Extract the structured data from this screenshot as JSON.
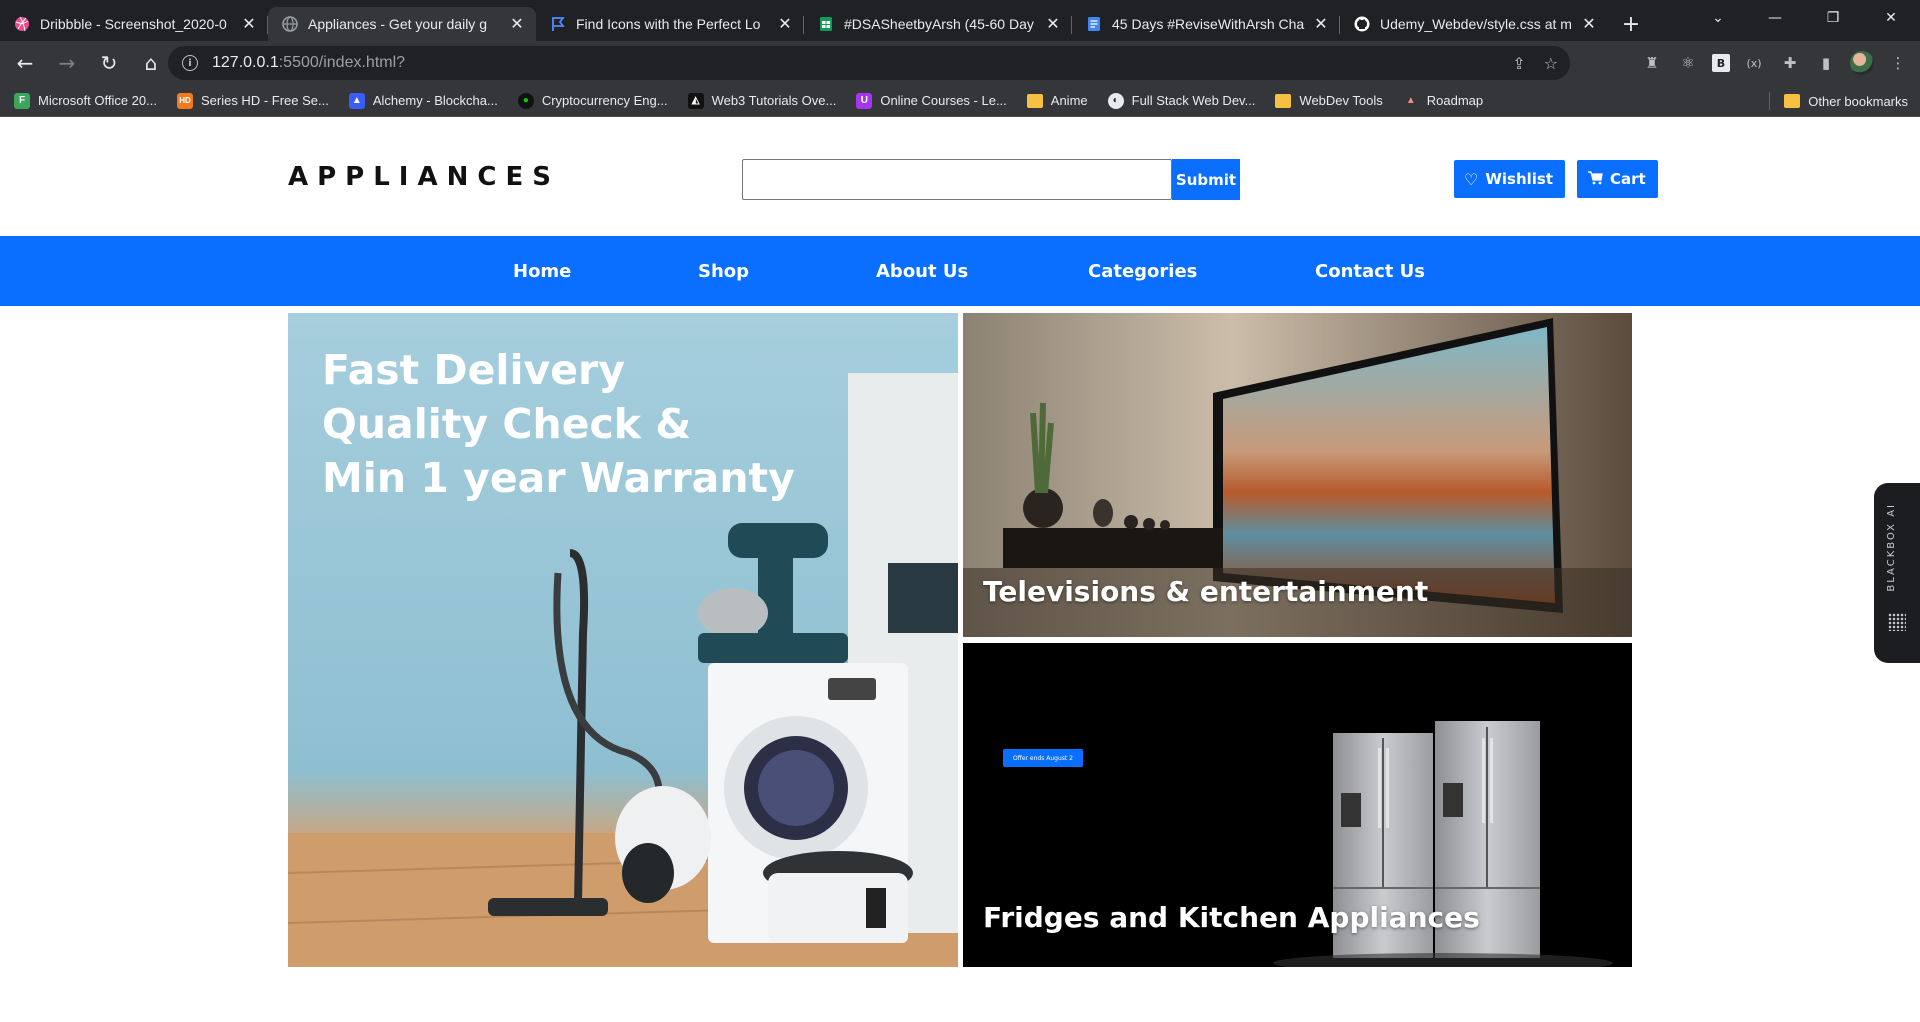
{
  "browser": {
    "tabs": [
      {
        "title": "Dribbble - Screenshot_2020-0",
        "icon": "dribbble-icon",
        "icon_color": "#ea4c89",
        "active": false
      },
      {
        "title": "Appliances - Get your daily g",
        "icon": "globe-icon",
        "icon_color": "#9aa0a6",
        "active": true
      },
      {
        "title": "Find Icons with the Perfect Lo",
        "icon": "flag-icon",
        "icon_color": "#4f8cff",
        "active": false
      },
      {
        "title": "#DSASheetbyArsh (45-60 Day",
        "icon": "sheets-icon",
        "icon_color": "#0f9d58",
        "active": false
      },
      {
        "title": "45 Days #ReviseWithArsh Cha",
        "icon": "docs-icon",
        "icon_color": "#4285f4",
        "active": false
      },
      {
        "title": "Udemy_Webdev/style.css at m",
        "icon": "github-icon",
        "icon_color": "#ffffff",
        "active": false
      }
    ],
    "address": {
      "host": "127.0.0.1",
      "path": ":5500/index.html?"
    },
    "bookmarks": [
      {
        "label": "Microsoft Office 20...",
        "icon": "office-icon",
        "color": "#3ca55c",
        "glyph": "F"
      },
      {
        "label": "Series HD - Free Se...",
        "icon": "hd-icon",
        "color": "#f07b1e",
        "glyph": "HD"
      },
      {
        "label": "Alchemy - Blockcha...",
        "icon": "alchemy-icon",
        "color": "#3b5bfd",
        "glyph": "▲"
      },
      {
        "label": "Cryptocurrency Eng...",
        "icon": "crypto-icon",
        "color": "#16c60c",
        "glyph": "●"
      },
      {
        "label": "Web3 Tutorials Ove...",
        "icon": "web3-icon",
        "color": "#111111",
        "glyph": "◭"
      },
      {
        "label": "Online Courses - Le...",
        "icon": "udemy-icon",
        "color": "#a435f0",
        "glyph": "U"
      },
      {
        "label": "Anime",
        "icon": "folder-icon",
        "color": "#f6c142",
        "glyph": ""
      },
      {
        "label": "Full Stack Web Dev...",
        "icon": "fullstack-icon",
        "color": "#e8eaed",
        "glyph": "◐"
      },
      {
        "label": "WebDev Tools",
        "icon": "folder-icon",
        "color": "#f6c142",
        "glyph": ""
      },
      {
        "label": "Roadmap",
        "icon": "rocket-icon",
        "color": "#35363a",
        "glyph": "🚀"
      }
    ],
    "other_bookmarks": "Other bookmarks"
  },
  "site": {
    "logo": "APPLIANCES",
    "search": {
      "placeholder": "",
      "button": "Submit"
    },
    "wishlist": "Wishlist",
    "cart": "Cart",
    "nav": [
      "Home",
      "Shop",
      "About Us",
      "Categories",
      "Contact Us"
    ],
    "hero": {
      "line1": "Fast Delivery",
      "line2": "Quality Check &",
      "line3": "Min 1 year Warranty"
    },
    "tv_caption": "Televisions & entertainment",
    "fridge_caption": "Fridges and Kitchen Appliances",
    "offer_badge": "Offer ends August 2"
  },
  "sidebar_widget": {
    "label": "BLACKBOX AI"
  },
  "colors": {
    "primary": "#0a6fff",
    "chrome_dark": "#202124",
    "chrome_mid": "#35363a"
  }
}
